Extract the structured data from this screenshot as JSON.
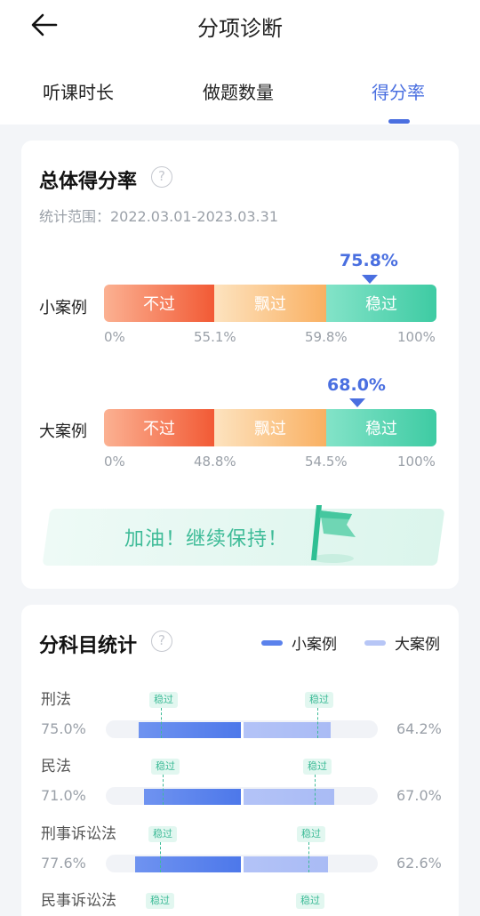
{
  "header": {
    "title": "分项诊断",
    "tabs": [
      {
        "label": "听课时长",
        "active": false
      },
      {
        "label": "做题数量",
        "active": false
      },
      {
        "label": "得分率",
        "active": true
      }
    ]
  },
  "overall": {
    "title": "总体得分率",
    "help": "?",
    "range": "统计范围：2022.03.01-2023.03.31",
    "segments": {
      "fail": "不过",
      "pass": "飘过",
      "steady": "稳过"
    },
    "rows": [
      {
        "label": "小案例",
        "score_label": "75.8%",
        "score": 75.8,
        "ticks": [
          "0%",
          "55.1%",
          "59.8%",
          "100%"
        ]
      },
      {
        "label": "大案例",
        "score_label": "68.0%",
        "score": 68.0,
        "ticks": [
          "0%",
          "48.8%",
          "54.5%",
          "100%"
        ]
      }
    ],
    "cheer": "加油！继续保持！"
  },
  "subjects": {
    "title": "分科目统计",
    "help": "?",
    "legend": {
      "small": "小案例",
      "big": "大案例"
    },
    "badge": "稳过",
    "colors": {
      "small": "#5b82ec",
      "big": "#aebff5",
      "badge": "#3dbb97"
    },
    "items": [
      {
        "name": "刑法",
        "left": "75.0%",
        "right": "64.2%",
        "small": 75.0,
        "big": 64.2
      },
      {
        "name": "民法",
        "left": "71.0%",
        "right": "67.0%",
        "small": 71.0,
        "big": 67.0
      },
      {
        "name": "刑事诉讼法",
        "left": "77.6%",
        "right": "62.6%",
        "small": 77.6,
        "big": 62.6
      },
      {
        "name": "民事诉讼法",
        "left": "",
        "right": "",
        "small": null,
        "big": null
      }
    ]
  }
}
